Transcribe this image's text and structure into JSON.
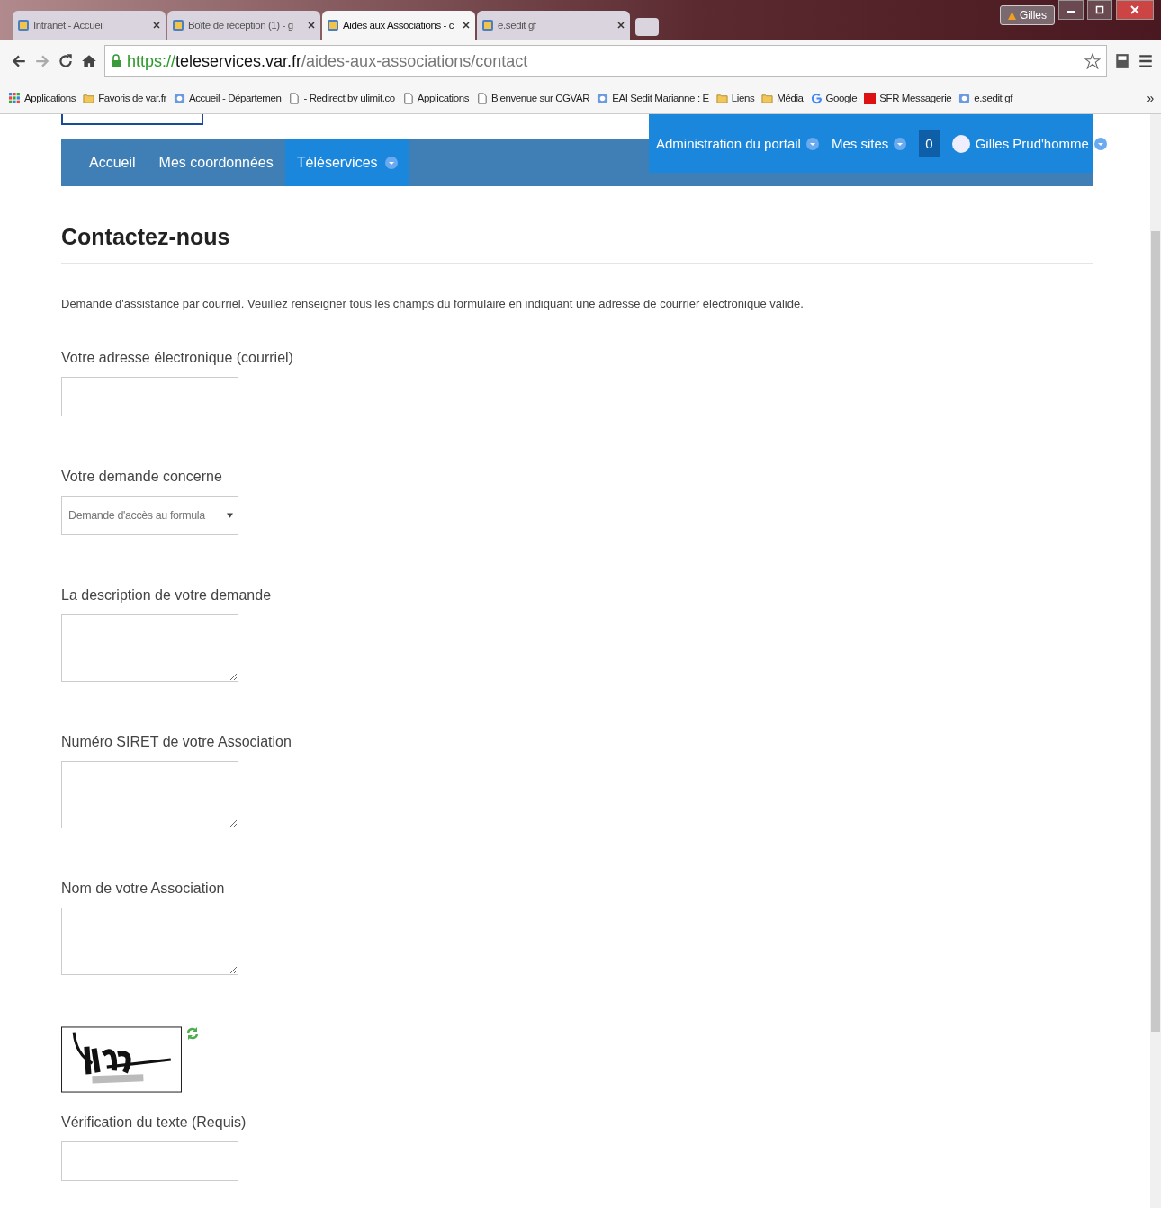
{
  "browser": {
    "tabs": [
      {
        "title": "Intranet - Accueil",
        "selected": false
      },
      {
        "title": "Boîte de réception (1) - g",
        "selected": false
      },
      {
        "title": "Aides aux Associations - c",
        "selected": true
      },
      {
        "title": "e.sedit gf",
        "selected": false
      }
    ],
    "profile": "Gilles",
    "url": {
      "scheme": "https://",
      "host": "teleservices.var.fr",
      "path": "/aides-aux-associations/contact"
    },
    "bookmarks": [
      {
        "label": "Applications",
        "kind": "apps"
      },
      {
        "label": "Favoris de var.fr",
        "kind": "folder"
      },
      {
        "label": "Accueil - Départemen",
        "kind": "site"
      },
      {
        "label": "- Redirect by ulimit.co",
        "kind": "page"
      },
      {
        "label": "Applications",
        "kind": "page"
      },
      {
        "label": "Bienvenue sur CGVAR",
        "kind": "page"
      },
      {
        "label": "EAI Sedit Marianne : E",
        "kind": "site"
      },
      {
        "label": "Liens",
        "kind": "folder"
      },
      {
        "label": "Média",
        "kind": "folder"
      },
      {
        "label": "Google",
        "kind": "google"
      },
      {
        "label": "SFR Messagerie",
        "kind": "sfr"
      },
      {
        "label": "e.sedit gf",
        "kind": "site"
      }
    ],
    "more": "»"
  },
  "nav": {
    "items": [
      {
        "label": "Accueil",
        "selected": false,
        "menu": false
      },
      {
        "label": "Mes coordonnées",
        "selected": false,
        "menu": false
      },
      {
        "label": "Téléservices",
        "selected": true,
        "menu": true
      }
    ],
    "right": [
      {
        "label": "Administration du portail",
        "kind": "menu"
      },
      {
        "label": "Mes sites",
        "kind": "menu"
      },
      {
        "label": "0",
        "kind": "badge"
      },
      {
        "label": "Gilles Prud'homme",
        "kind": "user"
      }
    ]
  },
  "title": "Contactez-nous",
  "intro": "Demande d'assistance par courriel. Veuillez renseigner tous les champs du formulaire en indiquant une adresse de courrier électronique valide.",
  "fields": [
    {
      "label": "Votre adresse électronique (courriel)",
      "kind": "input"
    },
    {
      "label": "Votre demande concerne",
      "kind": "select",
      "value": "Demande d'accès au formula"
    },
    {
      "label": "La description de votre demande",
      "kind": "textarea"
    },
    {
      "label": "Numéro SIRET de votre Association",
      "kind": "textarea"
    },
    {
      "label": "Nom de votre Association",
      "kind": "textarea"
    },
    {
      "kind": "captcha"
    },
    {
      "label": "Vérification du texte (Requis)",
      "kind": "input"
    }
  ]
}
